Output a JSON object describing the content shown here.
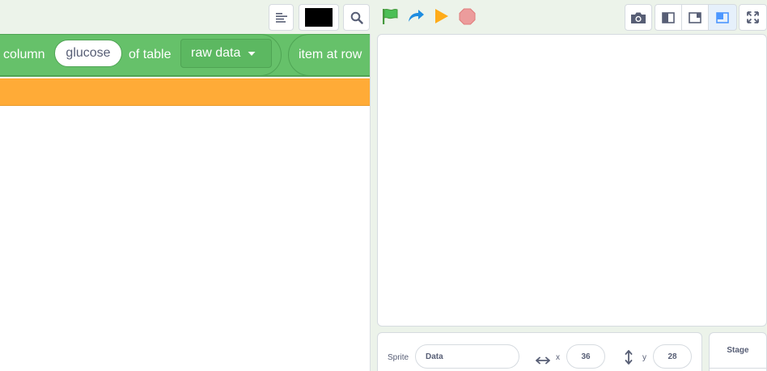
{
  "toolbar": {
    "icons": [
      "align-left-icon",
      "color-swatch",
      "search-icon"
    ],
    "swatch_color": "#000000"
  },
  "controls": {
    "icons": [
      "green-flag-icon",
      "turbo-icon",
      "run-icon",
      "stop-icon"
    ]
  },
  "view_buttons": [
    "camera-icon",
    "small-stage-icon",
    "normal-stage-icon",
    "large-stage-icon",
    "fullscreen-icon"
  ],
  "block": {
    "prefix": "column",
    "column_value": "glucose",
    "middle": "of table",
    "table_value": "raw data",
    "next": "item at row",
    "color": "#66c16a",
    "orange_color": "#ffab37"
  },
  "sprite": {
    "label": "Sprite",
    "name": "Data",
    "x_label": "x",
    "x_value": "36",
    "y_label": "y",
    "y_value": "28"
  },
  "stage_panel": {
    "title": "Stage"
  }
}
